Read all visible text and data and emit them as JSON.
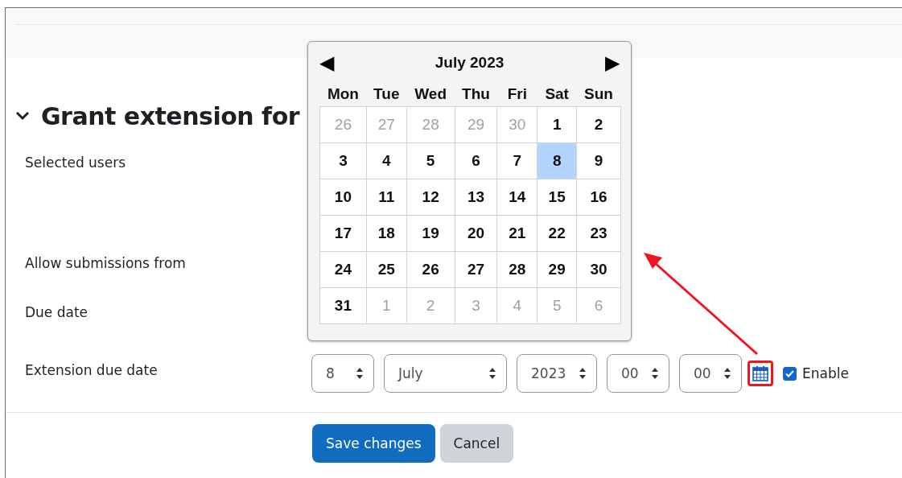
{
  "section": {
    "title": "Grant extension for",
    "expanded": true
  },
  "fields": [
    {
      "label": "Selected users"
    },
    {
      "label": "Allow submissions from"
    },
    {
      "label": "Due date"
    },
    {
      "label": "Extension due date"
    }
  ],
  "extension_date": {
    "selects": [
      {
        "value": "8",
        "kind": "narrow"
      },
      {
        "value": "July",
        "kind": "wide"
      },
      {
        "value": "2023",
        "kind": "medium"
      },
      {
        "value": "00",
        "kind": "narrow"
      },
      {
        "value": "00",
        "kind": "narrow"
      }
    ],
    "enable": {
      "label": "Enable",
      "checked": true
    }
  },
  "calendar": {
    "title": "July 2023",
    "prev": "◀",
    "next": "▶",
    "weekdays": [
      "Mon",
      "Tue",
      "Wed",
      "Thu",
      "Fri",
      "Sat",
      "Sun"
    ],
    "weeks": [
      [
        {
          "day": "26",
          "other_month": true,
          "selected": false
        },
        {
          "day": "27",
          "other_month": true,
          "selected": false
        },
        {
          "day": "28",
          "other_month": true,
          "selected": false
        },
        {
          "day": "29",
          "other_month": true,
          "selected": false
        },
        {
          "day": "30",
          "other_month": true,
          "selected": false
        },
        {
          "day": "1",
          "other_month": false,
          "selected": false
        },
        {
          "day": "2",
          "other_month": false,
          "selected": false
        }
      ],
      [
        {
          "day": "3",
          "other_month": false,
          "selected": false
        },
        {
          "day": "4",
          "other_month": false,
          "selected": false
        },
        {
          "day": "5",
          "other_month": false,
          "selected": false
        },
        {
          "day": "6",
          "other_month": false,
          "selected": false
        },
        {
          "day": "7",
          "other_month": false,
          "selected": false
        },
        {
          "day": "8",
          "other_month": false,
          "selected": true
        },
        {
          "day": "9",
          "other_month": false,
          "selected": false
        }
      ],
      [
        {
          "day": "10",
          "other_month": false,
          "selected": false
        },
        {
          "day": "11",
          "other_month": false,
          "selected": false
        },
        {
          "day": "12",
          "other_month": false,
          "selected": false
        },
        {
          "day": "13",
          "other_month": false,
          "selected": false
        },
        {
          "day": "14",
          "other_month": false,
          "selected": false
        },
        {
          "day": "15",
          "other_month": false,
          "selected": false
        },
        {
          "day": "16",
          "other_month": false,
          "selected": false
        }
      ],
      [
        {
          "day": "17",
          "other_month": false,
          "selected": false
        },
        {
          "day": "18",
          "other_month": false,
          "selected": false
        },
        {
          "day": "19",
          "other_month": false,
          "selected": false
        },
        {
          "day": "20",
          "other_month": false,
          "selected": false
        },
        {
          "day": "21",
          "other_month": false,
          "selected": false
        },
        {
          "day": "22",
          "other_month": false,
          "selected": false
        },
        {
          "day": "23",
          "other_month": false,
          "selected": false
        }
      ],
      [
        {
          "day": "24",
          "other_month": false,
          "selected": false
        },
        {
          "day": "25",
          "other_month": false,
          "selected": false
        },
        {
          "day": "26",
          "other_month": false,
          "selected": false
        },
        {
          "day": "27",
          "other_month": false,
          "selected": false
        },
        {
          "day": "28",
          "other_month": false,
          "selected": false
        },
        {
          "day": "29",
          "other_month": false,
          "selected": false
        },
        {
          "day": "30",
          "other_month": false,
          "selected": false
        }
      ],
      [
        {
          "day": "31",
          "other_month": false,
          "selected": false
        },
        {
          "day": "1",
          "other_month": true,
          "selected": false
        },
        {
          "day": "2",
          "other_month": true,
          "selected": false
        },
        {
          "day": "3",
          "other_month": true,
          "selected": false
        },
        {
          "day": "4",
          "other_month": true,
          "selected": false
        },
        {
          "day": "5",
          "other_month": true,
          "selected": false
        },
        {
          "day": "6",
          "other_month": true,
          "selected": false
        }
      ]
    ]
  },
  "buttons": [
    {
      "label": "Save changes",
      "kind": "primary"
    },
    {
      "label": "Cancel",
      "kind": "secondary"
    }
  ]
}
